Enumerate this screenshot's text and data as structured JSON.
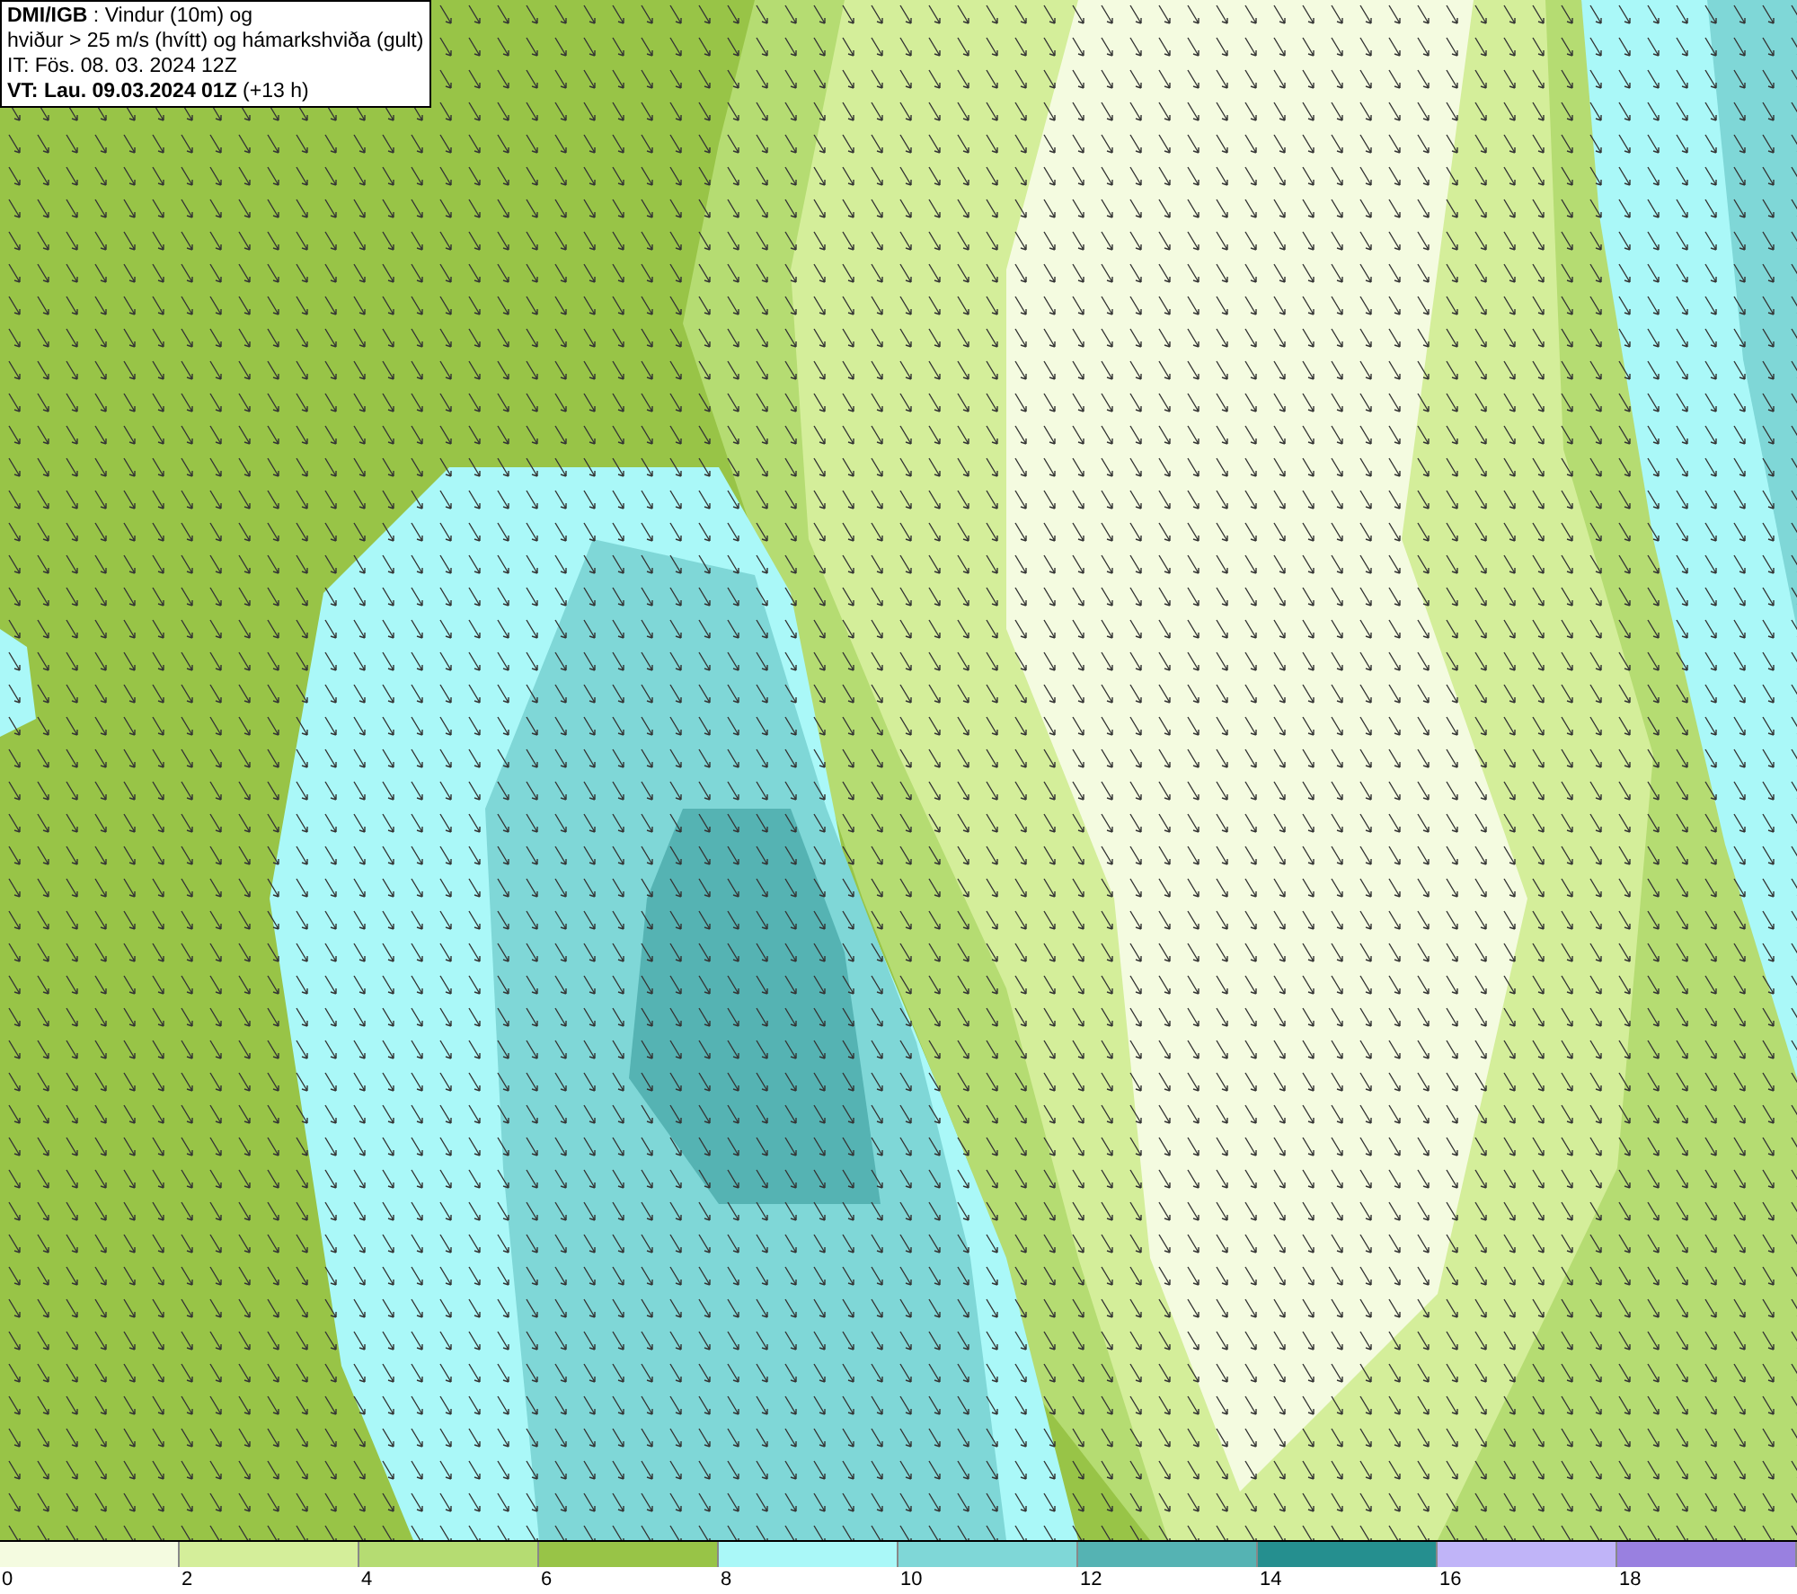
{
  "title_box": {
    "lines": [
      "**DMI/IGB** : Vindur (10m) og",
      "hviður > 25 m/s (hvítt) og hámarkshviða (gult)",
      "IT: Fös. 08. 03. 2024 12Z",
      "**VT: Lau. 09.03.2024 01Z** (+13 h)"
    ]
  },
  "legend": {
    "bins": [
      {
        "color": "#f4fbe0",
        "label": "0"
      },
      {
        "color": "#d4ee9a",
        "label": "2"
      },
      {
        "color": "#b5dc72",
        "label": "4"
      },
      {
        "color": "#98c447",
        "label": "6"
      },
      {
        "color": "#aaf8f8",
        "label": "8"
      },
      {
        "color": "#7fd7d7",
        "label": "10"
      },
      {
        "color": "#55b3b3",
        "label": "12"
      },
      {
        "color": "#258f8f",
        "label": "14"
      },
      {
        "color": "#c0b4f8",
        "label": "16"
      },
      {
        "color": "#9980e0",
        "label": "18"
      }
    ]
  }
}
